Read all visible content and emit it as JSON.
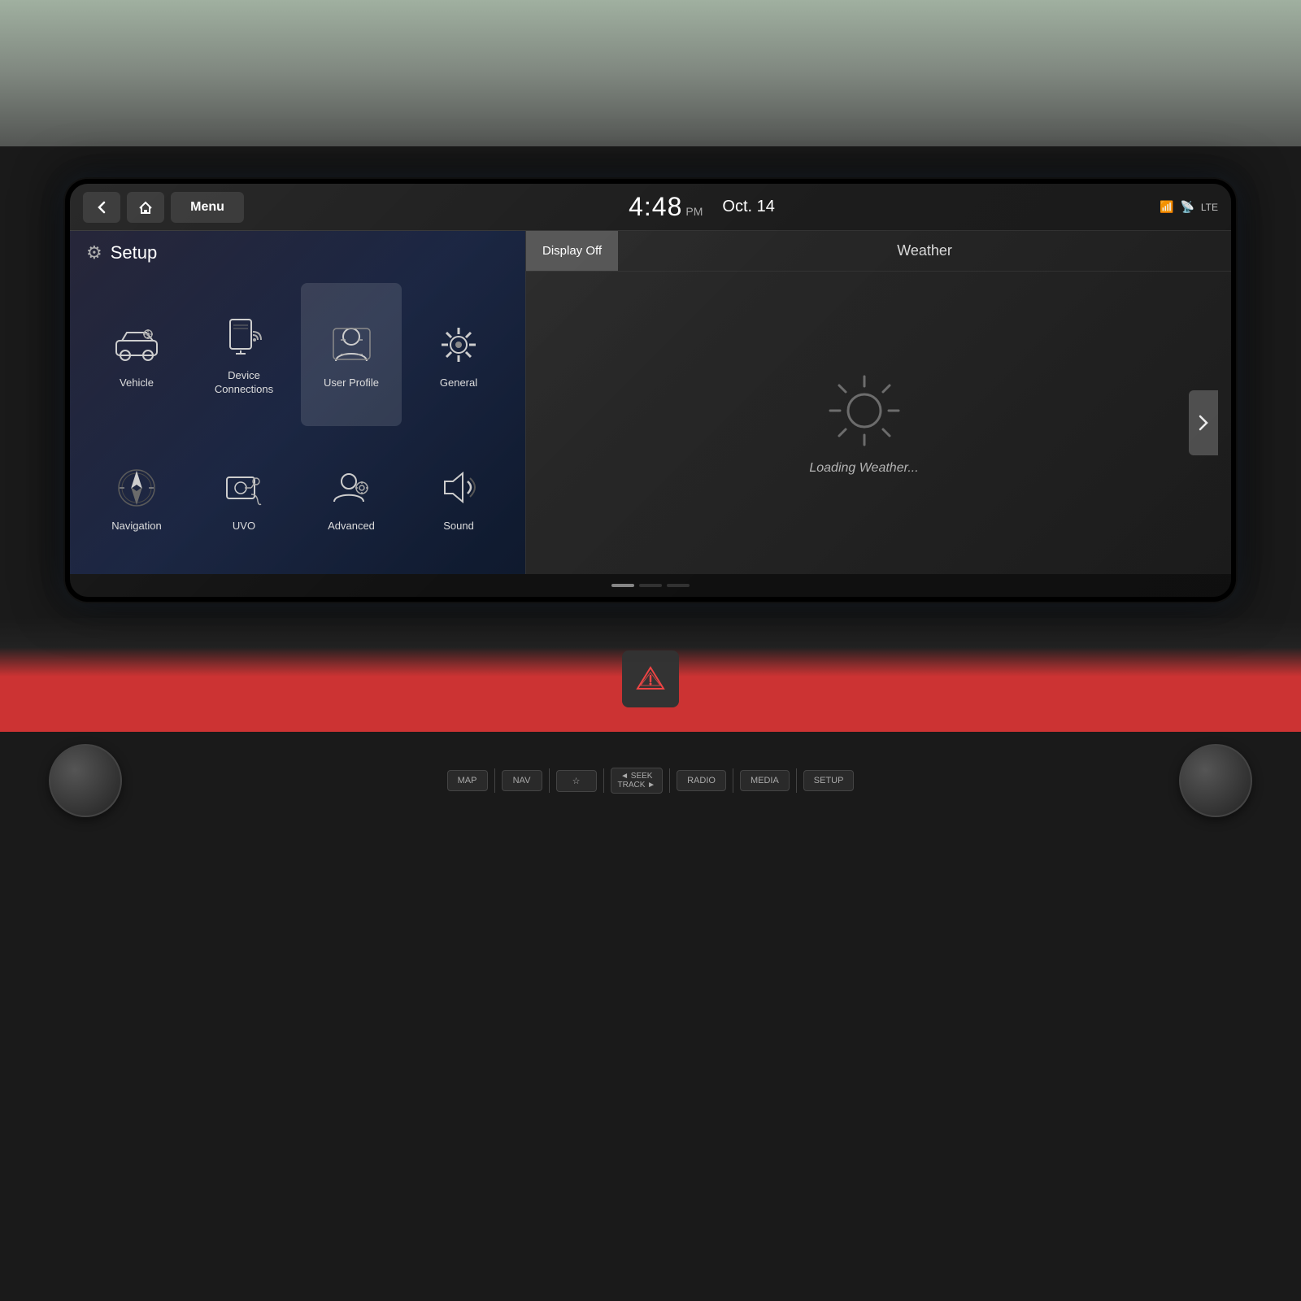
{
  "car": {
    "screen": {
      "topBar": {
        "backLabel": "←",
        "homeLabel": "⌂",
        "menuLabel": "Menu",
        "time": "4:48",
        "ampm": "PM",
        "date": "Oct. 14",
        "displayOffLabel": "Display Off"
      },
      "setupLabel": "Setup",
      "menuItems": [
        {
          "id": "vehicle",
          "label": "Vehicle",
          "icon": "vehicle"
        },
        {
          "id": "device-connections",
          "label": "Device\nConnections",
          "icon": "device"
        },
        {
          "id": "user-profile",
          "label": "User Profile",
          "icon": "user-profile"
        },
        {
          "id": "general",
          "label": "General",
          "icon": "general"
        },
        {
          "id": "navigation",
          "label": "Navigation",
          "icon": "navigation"
        },
        {
          "id": "uvo",
          "label": "UVO",
          "icon": "uvo"
        },
        {
          "id": "advanced",
          "label": "Advanced",
          "icon": "advanced"
        },
        {
          "id": "sound",
          "label": "Sound",
          "icon": "sound"
        }
      ],
      "rightPanel": {
        "displayOffLabel": "Display Off",
        "weatherLabel": "Weather",
        "loadingLabel": "Loading Weather..."
      },
      "pagination": {
        "dots": [
          "active",
          "inactive",
          "inactive"
        ]
      }
    },
    "bottomControls": {
      "buttons": [
        {
          "id": "map",
          "label": "MAP"
        },
        {
          "id": "nav",
          "label": "NAV"
        },
        {
          "id": "favorite",
          "label": "☆"
        },
        {
          "id": "seek-track",
          "label": "◄ SEEK\nTRACK ►"
        },
        {
          "id": "radio",
          "label": "RADIO"
        },
        {
          "id": "media",
          "label": "MEDIA"
        },
        {
          "id": "setup",
          "label": "SETUP"
        }
      ]
    }
  }
}
